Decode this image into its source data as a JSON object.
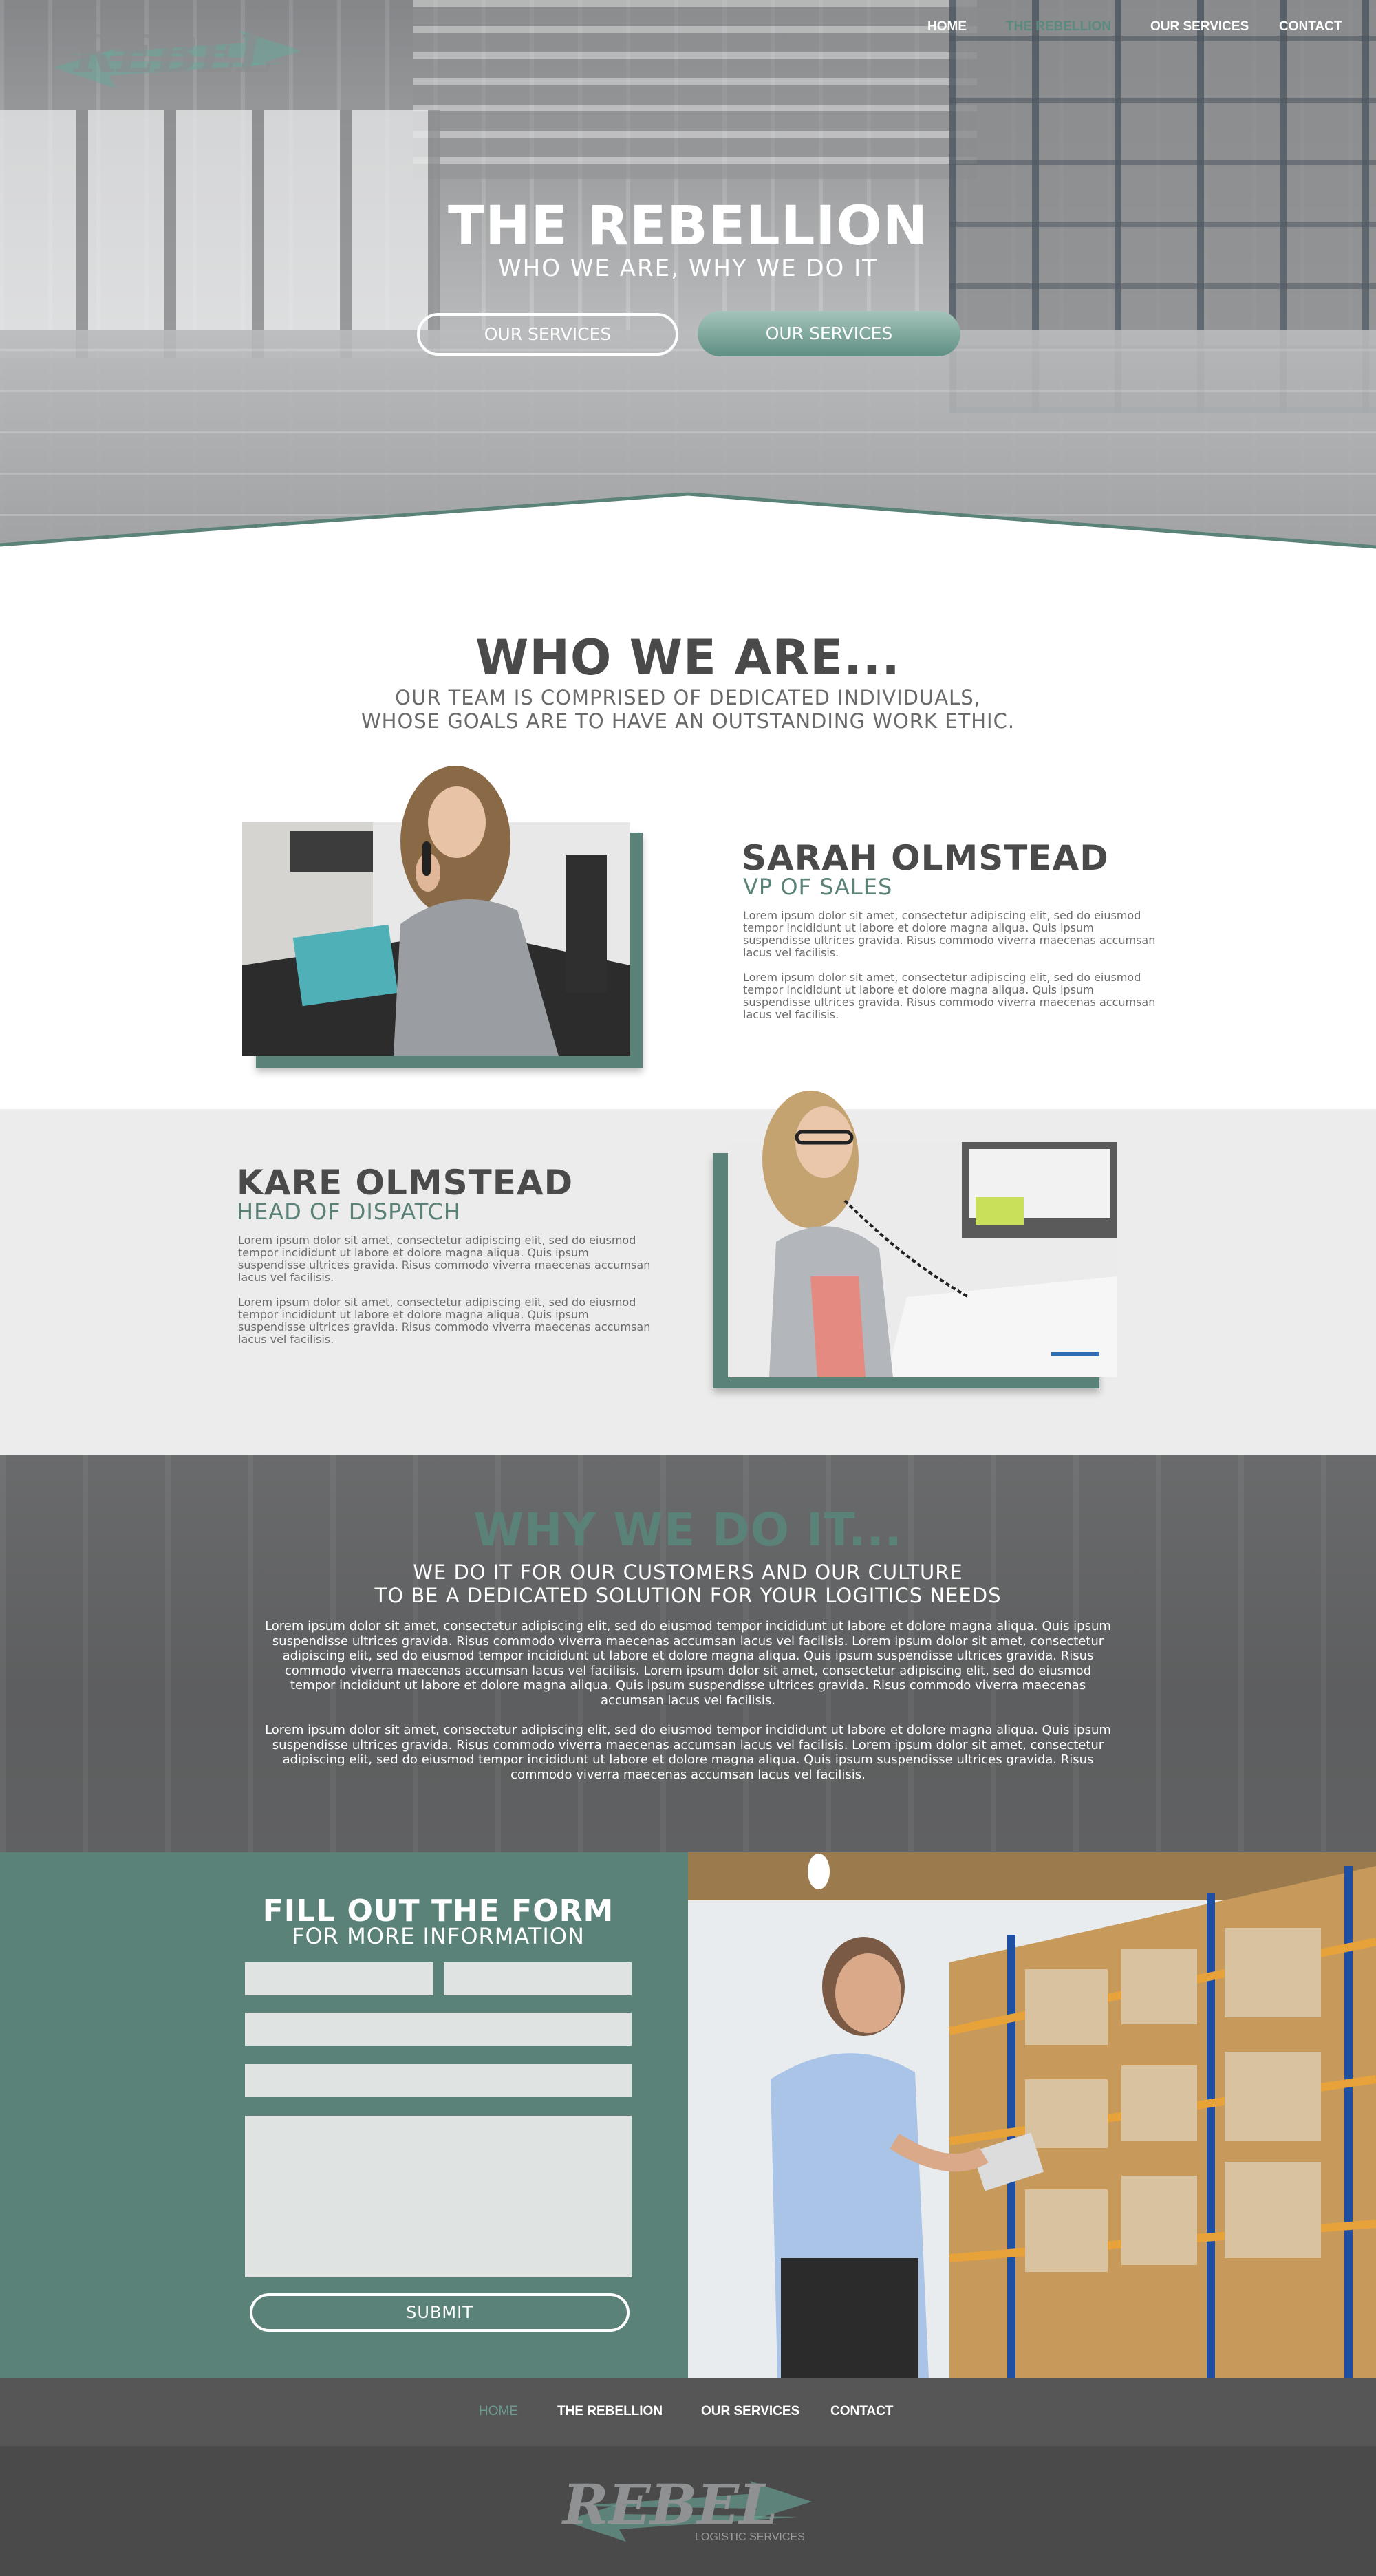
{
  "brand": {
    "accent": "#5b8278",
    "dark_text": "#4a4a4a",
    "band_grey": "#ececec",
    "footer_dark": "#4a4a4a"
  },
  "nav": {
    "items": [
      {
        "label": "HOME",
        "active": false
      },
      {
        "label": "THE REBELLION",
        "active": true
      },
      {
        "label": "OUR SERVICES",
        "active": false
      },
      {
        "label": "CONTACT",
        "active": false
      }
    ]
  },
  "hero": {
    "title": "THE REBELLION",
    "subtitle": "WHO WE ARE, WHY WE DO IT",
    "button_outline": "OUR SERVICES",
    "button_solid": "OUR SERVICES"
  },
  "who": {
    "title": "WHO WE ARE...",
    "subtitle_line1": "OUR TEAM IS COMPRISED OF DEDICATED INDIVIDUALS,",
    "subtitle_line2": "WHOSE GOALS ARE TO HAVE AN OUTSTANDING WORK ETHIC.",
    "people": [
      {
        "name": "SARAH OLMSTEAD",
        "role": "VP OF SALES",
        "paragraphs": [
          "Lorem ipsum dolor sit amet, consectetur adipiscing elit, sed do eiusmod tempor incididunt ut labore et dolore magna aliqua. Quis ipsum suspendisse ultrices gravida. Risus commodo viverra maecenas accumsan lacus vel facilisis.",
          "Lorem ipsum dolor sit amet, consectetur adipiscing elit, sed do eiusmod tempor incididunt ut labore et dolore magna aliqua. Quis ipsum suspendisse ultrices gravida. Risus commodo viverra maecenas accumsan lacus vel facilisis."
        ]
      },
      {
        "name": "KARE OLMSTEAD",
        "role": "HEAD OF DISPATCH",
        "paragraphs": [
          "Lorem ipsum dolor sit amet, consectetur adipiscing elit, sed do eiusmod tempor incididunt ut labore et dolore magna aliqua. Quis ipsum suspendisse ultrices gravida. Risus commodo viverra maecenas accumsan lacus vel facilisis.",
          "Lorem ipsum dolor sit amet, consectetur adipiscing elit, sed do eiusmod tempor incididunt ut labore et dolore magna aliqua. Quis ipsum suspendisse ultrices gravida. Risus commodo viverra maecenas accumsan lacus vel facilisis."
        ]
      }
    ]
  },
  "why": {
    "title": "WHY WE DO IT...",
    "subtitle_line1": "WE DO IT FOR OUR CUSTOMERS AND OUR CULTURE",
    "subtitle_line2": "TO BE A DEDICATED SOLUTION FOR YOUR LOGITICS NEEDS",
    "paragraphs": [
      "Lorem ipsum dolor sit amet, consectetur adipiscing elit, sed do eiusmod tempor incididunt ut labore et dolore magna aliqua. Quis ipsum suspendisse ultrices gravida. Risus commodo viverra maecenas accumsan lacus vel facilisis. Lorem ipsum dolor sit amet, consectetur adipiscing elit, sed do eiusmod tempor incididunt ut labore et dolore magna aliqua. Quis ipsum suspendisse ultrices gravida. Risus commodo viverra maecenas accumsan lacus vel facilisis. Lorem ipsum dolor sit amet, consectetur adipiscing elit, sed do eiusmod tempor incididunt ut labore et dolore magna aliqua. Quis ipsum suspendisse ultrices gravida. Risus commodo viverra maecenas accumsan lacus vel facilisis.",
      "Lorem ipsum dolor sit amet, consectetur adipiscing elit, sed do eiusmod tempor incididunt ut labore et dolore magna aliqua. Quis ipsum suspendisse ultrices gravida. Risus commodo viverra maecenas accumsan lacus vel facilisis. Lorem ipsum dolor sit amet, consectetur adipiscing elit, sed do eiusmod tempor incididunt ut labore et dolore magna aliqua. Quis ipsum suspendisse ultrices gravida. Risus commodo viverra maecenas accumsan lacus vel facilisis."
    ]
  },
  "form": {
    "title": "FILL OUT THE FORM",
    "subtitle": "FOR MORE INFORMATION",
    "first_name": "",
    "last_name": "",
    "field_3": "",
    "field_4": "",
    "message": "",
    "submit_label": "SUBMIT"
  },
  "footer": {
    "items": [
      {
        "label": "HOME",
        "active": true
      },
      {
        "label": "THE REBELLION",
        "active": false
      },
      {
        "label": "OUR SERVICES",
        "active": false
      },
      {
        "label": "CONTACT",
        "active": false
      }
    ],
    "logo_word": "REBEL",
    "logo_tagline": "LOGISTIC SERVICES"
  },
  "icons": {
    "logo": "rebel-arrow-logo"
  }
}
